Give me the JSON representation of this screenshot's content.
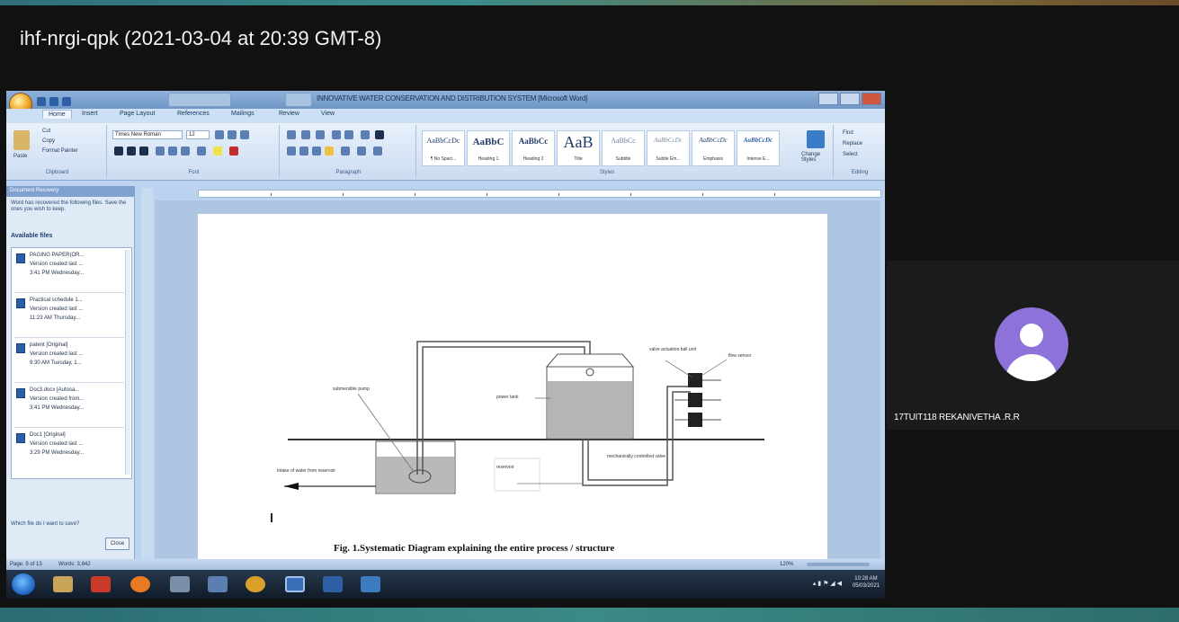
{
  "meeting": {
    "title": "ihf-nrgi-qpk (2021-03-04 at 20:39 GMT-8)"
  },
  "word": {
    "doc_title": "INNOVATIVE WATER CONSERVATION AND DISTRIBUTION SYSTEM [Microsoft Word]",
    "ribbon_tabs": [
      "Home",
      "Insert",
      "Page Layout",
      "References",
      "Mailings",
      "Review",
      "View"
    ],
    "clipboard": {
      "paste": "Paste",
      "cut": "Cut",
      "copy": "Copy",
      "format_painter": "Format Painter",
      "label": "Clipboard"
    },
    "font": {
      "name": "Times New Roman",
      "size": "12",
      "label": "Font"
    },
    "paragraph": {
      "label": "Paragraph"
    },
    "styles": {
      "items": [
        {
          "sample": "AaBbCcDc",
          "name": "¶ No Spaci..."
        },
        {
          "sample": "AaBbC",
          "name": "Heading 1"
        },
        {
          "sample": "AaBbCc",
          "name": "Heading 2"
        },
        {
          "sample": "AaB",
          "name": "Title"
        },
        {
          "sample": "AaBbCc",
          "name": "Subtitle"
        },
        {
          "sample": "AaBbCcDc",
          "name": "Subtle Em..."
        },
        {
          "sample": "AaBbCcDc",
          "name": "Emphasis"
        },
        {
          "sample": "AaBbCcDc",
          "name": "Intense E..."
        }
      ],
      "change": "Change Styles",
      "label": "Styles"
    },
    "editing": {
      "find": "Find",
      "replace": "Replace",
      "select": "Select",
      "label": "Editing"
    },
    "recovery": {
      "header": "Document Recovery",
      "text": "Word has recovered the following files. Save the ones you wish to keep.",
      "subheader": "Available files",
      "files": [
        {
          "name": "PAGING PAPER(OR...",
          "line2": "Version created last ...",
          "line3": "3:41 PM Wednesday..."
        },
        {
          "name": "Practical schedule 1...",
          "line2": "Version created last ...",
          "line3": "11:23 AM Thursday..."
        },
        {
          "name": "patent [Original]",
          "line2": "Version created last ...",
          "line3": "9:30 AM Tuesday, 1..."
        },
        {
          "name": "Doc3.docx [Autosa...",
          "line2": "Version created from...",
          "line3": "3:41 PM Wednesday..."
        },
        {
          "name": "Doc1 [Original]",
          "line2": "Version created last ...",
          "line3": "3:29 PM Wednesday..."
        }
      ],
      "help": "Which file do I want to save?",
      "close": "Close"
    },
    "diagram": {
      "labels": {
        "pump": "submersible pump",
        "tank": "power tank",
        "valve_unit": "valve actuation ball unit",
        "flow": "flow sensor",
        "intake": "Intake of water from reservoir",
        "reservoir": "reservoir",
        "manual_valve": "mechanically controlled valve"
      },
      "caption": "Fig. 1.Systematic Diagram explaining the entire process / structure"
    },
    "status": {
      "page": "Page: 9 of 13",
      "words": "Words: 3,842",
      "zoom": "120%"
    },
    "clock": {
      "time": "10:28 AM",
      "date": "05/03/2021"
    }
  },
  "participant": {
    "name": "17TUIT118 REKANIVETHA .R.R"
  },
  "icons": [
    "office-button-icon",
    "start-icon",
    "avatar-icon"
  ]
}
